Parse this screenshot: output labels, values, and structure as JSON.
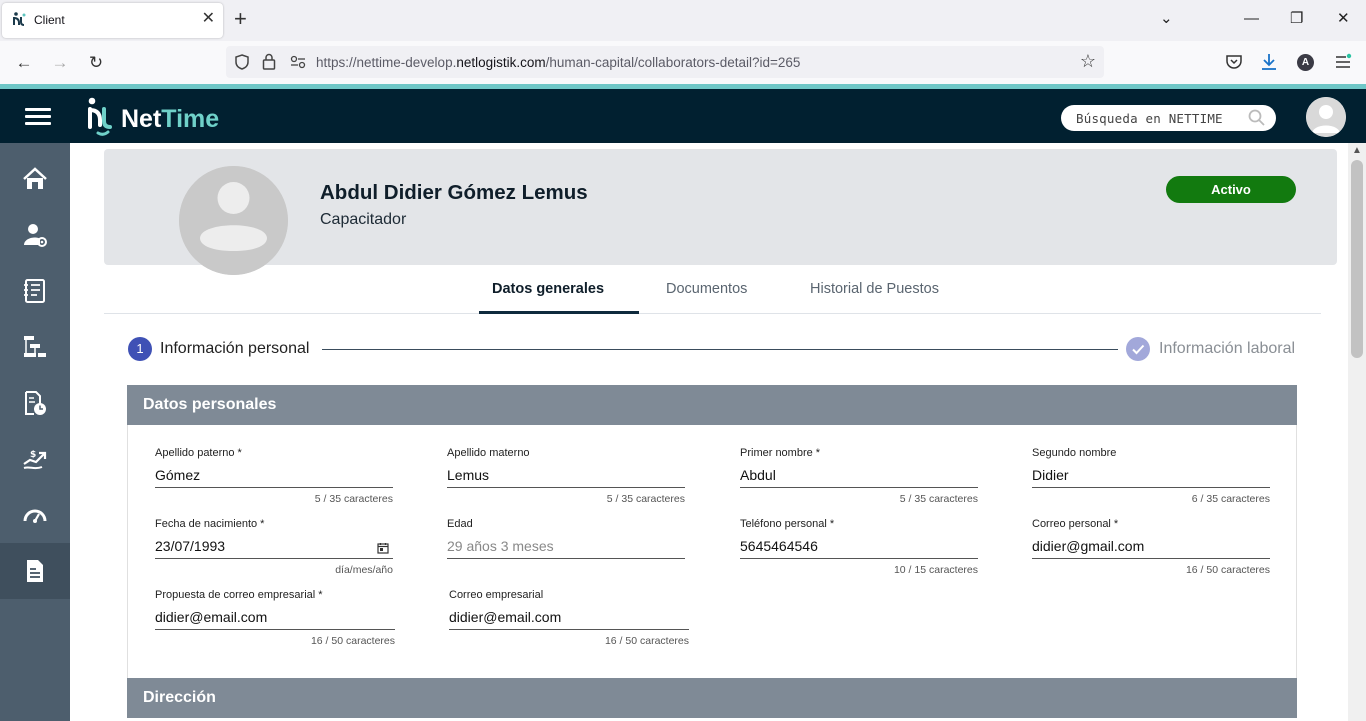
{
  "browser": {
    "tab_title": "Client",
    "url_prefix": "https://nettime-develop.",
    "url_domain": "netlogistik.com",
    "url_path": "/human-capital/collaborators-detail?id=265"
  },
  "app": {
    "logo_part1": "Net",
    "logo_part2": "Time",
    "search_placeholder": "Búsqueda en NETTIME",
    "sidebar_icons": [
      "home-icon",
      "user-settings-icon",
      "notebook-icon",
      "org-chart-icon",
      "document-clock-icon",
      "hand-growth-icon",
      "speedometer-icon",
      "report-document-icon"
    ]
  },
  "profile": {
    "name": "Abdul Didier Gómez Lemus",
    "role": "Capacitador",
    "status": "Activo"
  },
  "tabs": [
    "Datos generales",
    "Documentos",
    "Historial de Puestos"
  ],
  "stepper": {
    "step1_number": "1",
    "step1_label": "Información personal",
    "step2_label": "Información laboral"
  },
  "personal_section": {
    "title": "Datos personales",
    "fields": [
      {
        "label": "Apellido paterno *",
        "value": "Gómez",
        "hint": "5 / 35 caracteres"
      },
      {
        "label": "Apellido materno",
        "value": "Lemus",
        "hint": "5 / 35 caracteres"
      },
      {
        "label": "Primer nombre *",
        "value": "Abdul",
        "hint": "5 / 35 caracteres"
      },
      {
        "label": "Segundo nombre",
        "value": "Didier",
        "hint": "6 / 35 caracteres"
      },
      {
        "label": "Fecha de nacimiento *",
        "value": "23/07/1993",
        "hint": "día/mes/año"
      },
      {
        "label": "Edad",
        "value": "29 años 3 meses",
        "hint": ""
      },
      {
        "label": "Teléfono personal *",
        "value": "5645464546",
        "hint": "10 / 15 caracteres"
      },
      {
        "label": "Correo personal *",
        "value": "didier@gmail.com",
        "hint": "16 / 50 caracteres"
      },
      {
        "label": "Propuesta de correo empresarial *",
        "value": "didier@email.com",
        "hint": "16 / 50 caracteres"
      },
      {
        "label": "Correo empresarial",
        "value": "didier@email.com",
        "hint": "16 / 50 caracteres"
      }
    ]
  },
  "address_section": {
    "title": "Dirección"
  },
  "colors": {
    "header_bg": "#012030",
    "sidebar_bg": "#4d5e6d",
    "status_green": "#127a0f",
    "section_head": "#7f8a96",
    "stepper_active": "#3f51b5"
  }
}
